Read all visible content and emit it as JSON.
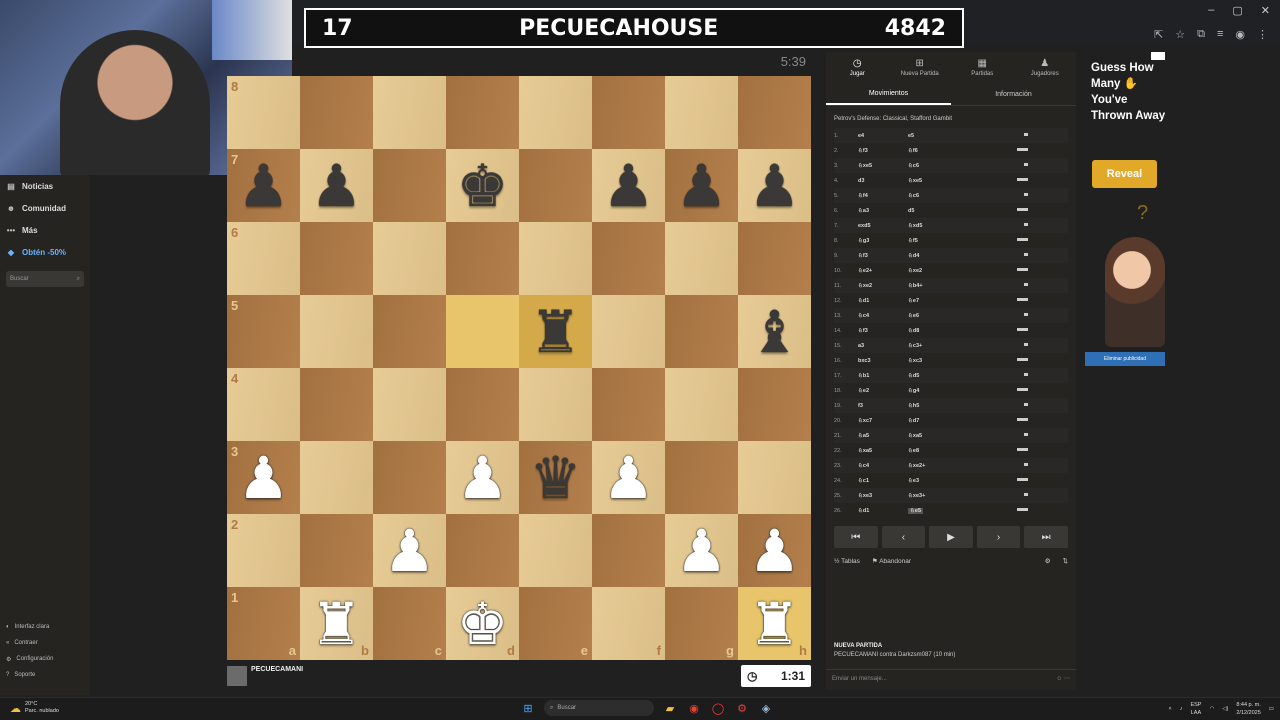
{
  "score": {
    "left": "17",
    "name": "PECUECAHOUSE",
    "right": "4842"
  },
  "opponent": {
    "clock": "5:39"
  },
  "player": {
    "name": "PECUECAMANI",
    "clock": "1:31"
  },
  "sidebar": {
    "items": [
      {
        "label": "Noticias",
        "icon": "news-icon"
      },
      {
        "label": "Comunidad",
        "icon": "community-icon"
      },
      {
        "label": "Más",
        "icon": "more-icon"
      },
      {
        "label": "Obtén -50%",
        "icon": "diamond-icon"
      }
    ],
    "search_placeholder": "Buscar",
    "bottom": [
      {
        "label": "Interfaz clara",
        "icon": "sun-icon"
      },
      {
        "label": "Contraer",
        "icon": "collapse-icon"
      },
      {
        "label": "Configuración",
        "icon": "gear-icon"
      },
      {
        "label": "Soporte",
        "icon": "help-icon"
      }
    ]
  },
  "board": {
    "ranks": [
      "8",
      "7",
      "6",
      "5",
      "4",
      "3",
      "2",
      "1"
    ],
    "files": [
      "a",
      "b",
      "c",
      "d",
      "e",
      "f",
      "g",
      "h"
    ],
    "position": [
      [
        "",
        "",
        "",
        "",
        "",
        "",
        "",
        ""
      ],
      [
        "bp",
        "bp",
        "",
        "bk",
        "",
        "bp",
        "bp",
        "bp"
      ],
      [
        "",
        "",
        "",
        "",
        "",
        "",
        "",
        ""
      ],
      [
        "",
        "",
        "",
        "",
        "br",
        "",
        "",
        "bb"
      ],
      [
        "",
        "",
        "",
        "",
        "",
        "",
        "",
        ""
      ],
      [
        "wp",
        "",
        "",
        "wp",
        "bq",
        "wp",
        "",
        ""
      ],
      [
        "",
        "",
        "wp",
        "",
        "",
        "",
        "wp",
        "wp"
      ],
      [
        "",
        "wr",
        "",
        "wk",
        "",
        "",
        "",
        "wr"
      ]
    ],
    "highlights": [
      "d5",
      "e5",
      "h1"
    ]
  },
  "panel": {
    "tabs": [
      {
        "label": "Jugar",
        "icon": "clock-icon",
        "active": true
      },
      {
        "label": "Nueva Partida",
        "icon": "plus-icon",
        "active": false
      },
      {
        "label": "Partidas",
        "icon": "grid-icon",
        "active": false
      },
      {
        "label": "Jugadores",
        "icon": "players-icon",
        "active": false
      }
    ],
    "subtabs": [
      {
        "label": "Movimientos",
        "active": true
      },
      {
        "label": "Información",
        "active": false
      }
    ],
    "opening": "Petrov's Defense: Classical, Stafford Gambit",
    "moves": [
      {
        "n": "1.",
        "w": "e4",
        "b": "e5"
      },
      {
        "n": "2.",
        "w": "♘f3",
        "b": "♘f6"
      },
      {
        "n": "3.",
        "w": "♘xe5",
        "b": "♘c6"
      },
      {
        "n": "4.",
        "w": "d3",
        "b": "♘xe5"
      },
      {
        "n": "5.",
        "w": "♘f4",
        "b": "♘c6"
      },
      {
        "n": "6.",
        "w": "♘a3",
        "b": "d5"
      },
      {
        "n": "7.",
        "w": "exd5",
        "b": "♘xd5"
      },
      {
        "n": "8.",
        "w": "♘g3",
        "b": "♘f5"
      },
      {
        "n": "9.",
        "w": "♘f3",
        "b": "♘d4"
      },
      {
        "n": "10.",
        "w": "♘e2+",
        "b": "♘xe2"
      },
      {
        "n": "11.",
        "w": "♘xe2",
        "b": "♘b4+"
      },
      {
        "n": "12.",
        "w": "♘d1",
        "b": "♘e7"
      },
      {
        "n": "13.",
        "w": "♘c4",
        "b": "♘e6"
      },
      {
        "n": "14.",
        "w": "♘f3",
        "b": "♘d8"
      },
      {
        "n": "15.",
        "w": "a3",
        "b": "♘c3+"
      },
      {
        "n": "16.",
        "w": "bxc3",
        "b": "♘xc3"
      },
      {
        "n": "17.",
        "w": "♘b1",
        "b": "♘d5"
      },
      {
        "n": "18.",
        "w": "♘e2",
        "b": "♘g4"
      },
      {
        "n": "19.",
        "w": "f3",
        "b": "♘h5"
      },
      {
        "n": "20.",
        "w": "♘xc7",
        "b": "♘d7"
      },
      {
        "n": "21.",
        "w": "♘a5",
        "b": "♘xa5"
      },
      {
        "n": "22.",
        "w": "♘xa5",
        "b": "♘e8"
      },
      {
        "n": "23.",
        "w": "♘c4",
        "b": "♘xe2+"
      },
      {
        "n": "24.",
        "w": "♘c1",
        "b": "♘e3"
      },
      {
        "n": "25.",
        "w": "♘xe3",
        "b": "♘xe3+"
      },
      {
        "n": "26.",
        "w": "♘d1",
        "b": "♘e5"
      }
    ],
    "draw_label": "Tablas",
    "resign_label": "Abandonar",
    "game_title": "NUEVA PARTIDA",
    "game_desc": "PECUECAMANI contra Darkzsm087 (10 min)",
    "chat_placeholder": "Enviar un mensaje..."
  },
  "ad": {
    "text": "Guess How Many ✋ You've Thrown Away",
    "button": "Reveal",
    "remove": "Eliminar publicidad"
  },
  "taskbar": {
    "temp": "20°C",
    "weather": "Parc. nublado",
    "search": "Buscar",
    "lang1": "ESP",
    "lang2": "LAA",
    "time": "8:44 p. m.",
    "date": "2/12/2025"
  },
  "colors": {
    "light_square": "#e6c88f",
    "dark_square": "#b07a45",
    "highlight": "#d4a94a",
    "reveal": "#e2a928"
  }
}
